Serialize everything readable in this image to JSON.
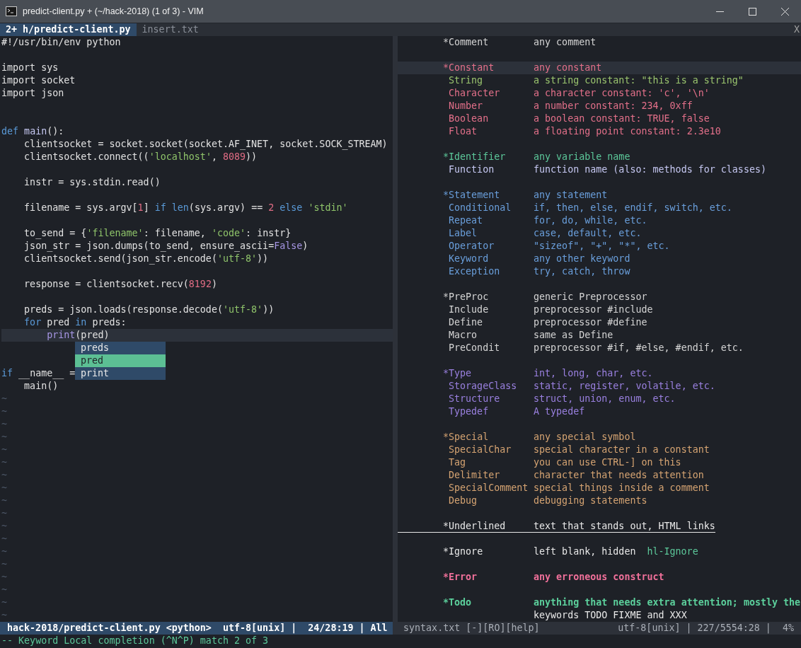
{
  "window": {
    "title": "predict-client.py + (~/hack-2018) (1 of 3) - VIM"
  },
  "tabs": [
    {
      "label": "2+ h/predict-client.py",
      "selected": true
    },
    {
      "label": "insert.txt",
      "selected": false
    }
  ],
  "tab_close": "X",
  "left_pane": {
    "lines": [
      {
        "cursor": false,
        "segments": [
          {
            "kind": "plain",
            "text": "#!/usr/bin/env python"
          }
        ]
      },
      {
        "cursor": false
      },
      {
        "cursor": false,
        "segments": [
          {
            "kind": "plain",
            "text": "import sys"
          }
        ]
      },
      {
        "cursor": false,
        "segments": [
          {
            "kind": "plain",
            "text": "import socket"
          }
        ]
      },
      {
        "cursor": false,
        "segments": [
          {
            "kind": "plain",
            "text": "import json"
          }
        ]
      },
      {
        "cursor": false
      },
      {
        "cursor": false
      },
      {
        "cursor": false,
        "segments": [
          {
            "kind": "keyword",
            "text": "def"
          },
          {
            "kind": "function",
            "text": " main"
          },
          {
            "kind": "plain",
            "text": "():"
          }
        ]
      },
      {
        "cursor": false,
        "segments": [
          {
            "kind": "plain",
            "text": "    clientsocket = socket.socket(socket.AF_INET, socket.SOCK_STREAM)"
          }
        ]
      },
      {
        "cursor": false,
        "segments": [
          {
            "kind": "plain",
            "text": "    clientsocket.connect(("
          },
          {
            "kind": "string",
            "text": "'localhost'"
          },
          {
            "kind": "plain",
            "text": ", "
          },
          {
            "kind": "number",
            "text": "8089"
          },
          {
            "kind": "plain",
            "text": "))"
          }
        ]
      },
      {
        "cursor": false
      },
      {
        "cursor": false,
        "segments": [
          {
            "kind": "plain",
            "text": "    instr = sys.stdin.read()"
          }
        ]
      },
      {
        "cursor": false
      },
      {
        "cursor": false,
        "segments": [
          {
            "kind": "plain",
            "text": "    filename = sys.argv["
          },
          {
            "kind": "number",
            "text": "1"
          },
          {
            "kind": "plain",
            "text": "] "
          },
          {
            "kind": "keyword",
            "text": "if"
          },
          {
            "kind": "keyword",
            "text": " len"
          },
          {
            "kind": "plain",
            "text": "(sys.argv) == "
          },
          {
            "kind": "number",
            "text": "2"
          },
          {
            "kind": "keyword",
            "text": " else"
          },
          {
            "kind": "string",
            "text": " 'stdin'"
          }
        ]
      },
      {
        "cursor": false
      },
      {
        "cursor": false,
        "segments": [
          {
            "kind": "plain",
            "text": "    to_send = {"
          },
          {
            "kind": "string",
            "text": "'filename'"
          },
          {
            "kind": "plain",
            "text": ": filename, "
          },
          {
            "kind": "string",
            "text": "'code'"
          },
          {
            "kind": "plain",
            "text": ": instr}"
          }
        ]
      },
      {
        "cursor": false,
        "segments": [
          {
            "kind": "plain",
            "text": "    json_str = json.dumps(to_send, ensure_ascii="
          },
          {
            "kind": "builtin",
            "text": "False"
          },
          {
            "kind": "plain",
            "text": ")"
          }
        ]
      },
      {
        "cursor": false,
        "segments": [
          {
            "kind": "plain",
            "text": "    clientsocket.send(json_str.encode("
          },
          {
            "kind": "string",
            "text": "'utf-8'"
          },
          {
            "kind": "plain",
            "text": "))"
          }
        ]
      },
      {
        "cursor": false
      },
      {
        "cursor": false,
        "segments": [
          {
            "kind": "plain",
            "text": "    response = clientsocket.recv("
          },
          {
            "kind": "number",
            "text": "8192"
          },
          {
            "kind": "plain",
            "text": ")"
          }
        ]
      },
      {
        "cursor": false
      },
      {
        "cursor": false,
        "segments": [
          {
            "kind": "plain",
            "text": "    preds = json.loads(response.decode("
          },
          {
            "kind": "string",
            "text": "'utf-8'"
          },
          {
            "kind": "plain",
            "text": "))"
          }
        ]
      },
      {
        "cursor": false,
        "segments": [
          {
            "kind": "keyword",
            "text": "    for"
          },
          {
            "kind": "plain",
            "text": " pred "
          },
          {
            "kind": "keyword",
            "text": "in"
          },
          {
            "kind": "plain",
            "text": " preds:"
          }
        ]
      },
      {
        "cursor": true,
        "segments": [
          {
            "kind": "builtin",
            "text": "        print"
          },
          {
            "kind": "plain",
            "text": "(pred)"
          }
        ]
      },
      {
        "cursor": false
      },
      {
        "cursor": false
      },
      {
        "cursor": false,
        "segments": [
          {
            "kind": "keyword",
            "text": "if"
          },
          {
            "kind": "plain",
            "text": " __name__ ="
          }
        ]
      },
      {
        "cursor": false,
        "segments": [
          {
            "kind": "plain",
            "text": "    main()"
          }
        ]
      }
    ],
    "completion_menu": {
      "items": [
        {
          "label": "preds",
          "selected": false
        },
        {
          "label": "pred",
          "selected": true
        },
        {
          "label": "print",
          "selected": false
        }
      ]
    },
    "tildes": [
      "~",
      "~",
      "~",
      "~",
      "~",
      "~",
      "~",
      "~",
      "~",
      "~",
      "~",
      "~",
      "~",
      "~",
      "~",
      "~",
      "~",
      "~"
    ]
  },
  "right_pane": {
    "groups": [
      {
        "items": [
          {
            "kind": "group",
            "name": "*Comment",
            "description": "any comment",
            "color": "#d4d4d4",
            "cursor": false
          }
        ]
      },
      {
        "items": [
          {
            "kind": "group",
            "name": "*Constant",
            "description": "any constant",
            "color": "#e4708a",
            "cursor": true
          },
          {
            "kind": "member",
            "name": "String",
            "description": "a string constant: \"this is a string\"",
            "color": "#9ac46e",
            "cursor": false
          },
          {
            "kind": "member",
            "name": "Character",
            "description": "a character constant: 'c', '\\n'",
            "color": "#e4708a",
            "cursor": false
          },
          {
            "kind": "member",
            "name": "Number",
            "description": "a number constant: 234, 0xff",
            "color": "#e4708a",
            "cursor": false
          },
          {
            "kind": "member",
            "name": "Boolean",
            "description": "a boolean constant: TRUE, false",
            "color": "#e4708a",
            "cursor": false
          },
          {
            "kind": "member",
            "name": "Float",
            "description": "a floating point constant: 2.3e10",
            "color": "#e4708a",
            "cursor": false
          }
        ]
      },
      {
        "items": [
          {
            "kind": "group",
            "name": "*Identifier",
            "description": "any variable name",
            "color": "#5cc89a",
            "cursor": false
          },
          {
            "kind": "member",
            "name": "Function",
            "description": "function name (also: methods for classes)",
            "color": "#c6c8f2",
            "cursor": false
          }
        ]
      },
      {
        "items": [
          {
            "kind": "group",
            "name": "*Statement",
            "description": "any statement",
            "color": "#6a9fdc",
            "cursor": false
          },
          {
            "kind": "member",
            "name": "Conditional",
            "description": "if, then, else, endif, switch, etc.",
            "color": "#6a9fdc",
            "cursor": false
          },
          {
            "kind": "member",
            "name": "Repeat",
            "description": "for, do, while, etc.",
            "color": "#6a9fdc",
            "cursor": false
          },
          {
            "kind": "member",
            "name": "Label",
            "description": "case, default, etc.",
            "color": "#6a9fdc",
            "cursor": false
          },
          {
            "kind": "member",
            "name": "Operator",
            "description": "\"sizeof\", \"+\", \"*\", etc.",
            "color": "#6a9fdc",
            "cursor": false
          },
          {
            "kind": "member",
            "name": "Keyword",
            "description": "any other keyword",
            "color": "#6a9fdc",
            "cursor": false
          },
          {
            "kind": "member",
            "name": "Exception",
            "description": "try, catch, throw",
            "color": "#6a9fdc",
            "cursor": false
          }
        ]
      },
      {
        "items": [
          {
            "kind": "group",
            "name": "*PreProc",
            "description": "generic Preprocessor",
            "color": "#d4d4d4",
            "cursor": false
          },
          {
            "kind": "member",
            "name": "Include",
            "description": "preprocessor #include",
            "color": "#d4d4d4",
            "cursor": false
          },
          {
            "kind": "member",
            "name": "Define",
            "description": "preprocessor #define",
            "color": "#d4d4d4",
            "cursor": false
          },
          {
            "kind": "member",
            "name": "Macro",
            "description": "same as Define",
            "color": "#d4d4d4",
            "cursor": false
          },
          {
            "kind": "member",
            "name": "PreCondit",
            "description": "preprocessor #if, #else, #endif, etc.",
            "color": "#d4d4d4",
            "cursor": false
          }
        ]
      },
      {
        "items": [
          {
            "kind": "group",
            "name": "*Type",
            "description": "int, long, char, etc.",
            "color": "#9a80e0",
            "cursor": false
          },
          {
            "kind": "member",
            "name": "StorageClass",
            "description": "static, register, volatile, etc.",
            "color": "#9a80e0",
            "cursor": false
          },
          {
            "kind": "member",
            "name": "Structure",
            "description": "struct, union, enum, etc.",
            "color": "#9a80e0",
            "cursor": false
          },
          {
            "kind": "member",
            "name": "Typedef",
            "description": "A typedef",
            "color": "#9a80e0",
            "cursor": false
          }
        ]
      },
      {
        "items": [
          {
            "kind": "group",
            "name": "*Special",
            "description": "any special symbol",
            "color": "#d6a472",
            "cursor": false
          },
          {
            "kind": "member",
            "name": "SpecialChar",
            "description": "special character in a constant",
            "color": "#d6a472",
            "cursor": false
          },
          {
            "kind": "member",
            "name": "Tag",
            "description": "you can use CTRL-] on this",
            "color": "#d6a472",
            "cursor": false
          },
          {
            "kind": "member",
            "name": "Delimiter",
            "description": "character that needs attention",
            "color": "#d6a472",
            "cursor": false
          },
          {
            "kind": "member",
            "name": "SpecialComment",
            "description": "special things inside a comment",
            "color": "#d6a472",
            "cursor": false
          },
          {
            "kind": "member",
            "name": "Debug",
            "description": "debugging statements",
            "color": "#d6a472",
            "cursor": false
          }
        ]
      },
      {
        "items": [
          {
            "kind": "underlined",
            "name": "*Underlined",
            "description": "text that stands out, HTML links",
            "color": "#e8e8e8",
            "cursor": false
          }
        ]
      },
      {
        "items": [
          {
            "kind": "group",
            "name": "*Ignore",
            "description": "left blank, hidden",
            "note": "hl-Ignore",
            "color": "#e8e8e8",
            "cursor": false
          }
        ]
      },
      {
        "items": [
          {
            "kind": "bold",
            "name": "*Error",
            "description": "any erroneous construct",
            "color": "#f0709a",
            "cursor": false
          }
        ]
      },
      {
        "items": [
          {
            "kind": "bold",
            "name": "*Todo",
            "description": "anything that needs extra attention; mostly the",
            "color": "#5cd09c",
            "cursor": false
          },
          {
            "kind": "continuation",
            "description": "keywords TODO FIXME and XXX",
            "color": "#e8e8e8",
            "cursor": false
          }
        ]
      }
    ]
  },
  "status_bars": {
    "left": "hack-2018/predict-client.py <python>  utf-8[unix] |  24/28:19 | All",
    "right": {
      "file": "syntax.txt [-][RO][help]",
      "position": "utf-8[unix] | 227/5554:28 |  4%"
    }
  },
  "command_line": "-- Keyword Local completion (^N^P) match 2 of 3"
}
